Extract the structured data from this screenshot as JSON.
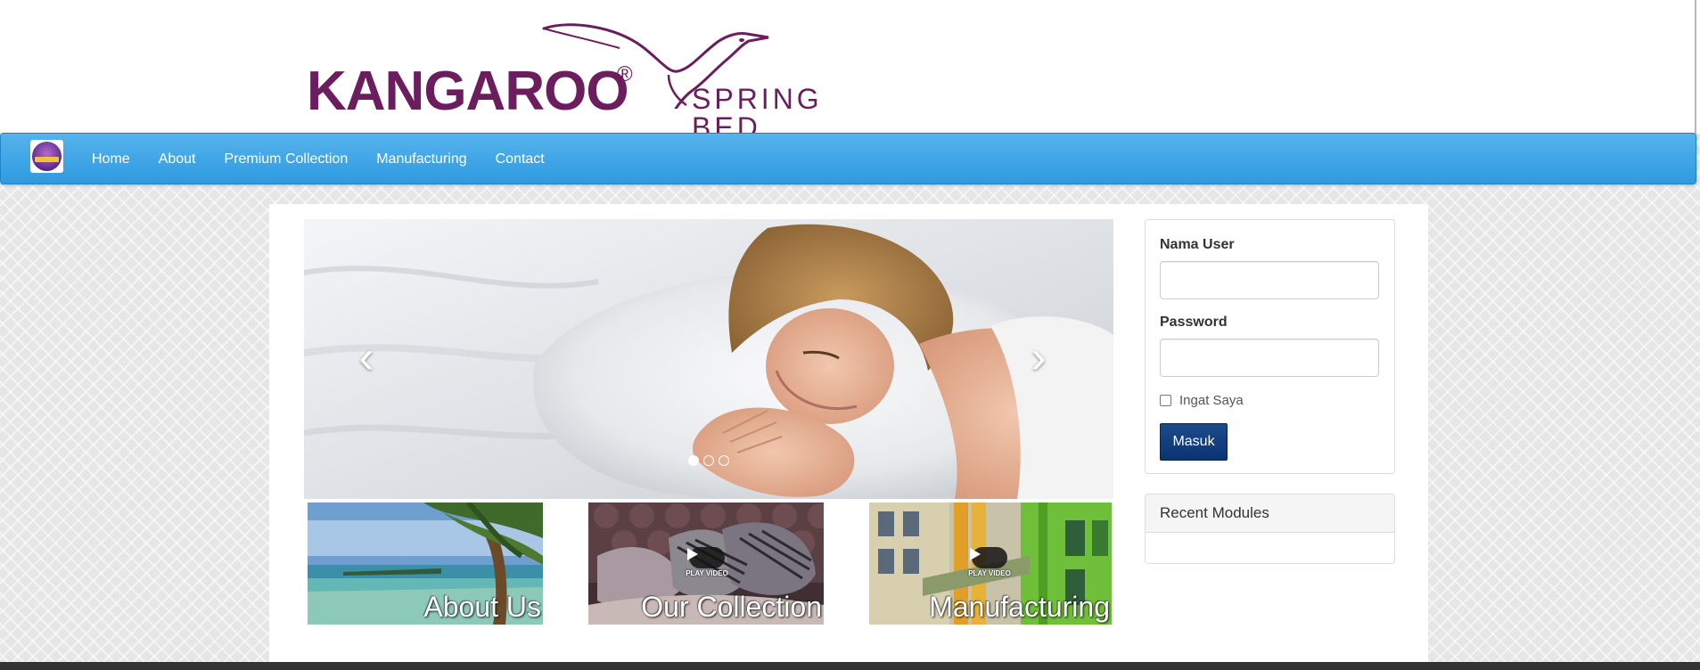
{
  "logo": {
    "wordmark": "KANGAROO",
    "registered": "®",
    "tagline": "SPRING BED",
    "color": "#6b1d5d"
  },
  "navbar": {
    "brand_icon": "kangaroo-badge-icon",
    "items": [
      {
        "label": "Home"
      },
      {
        "label": "About"
      },
      {
        "label": "Premium Collection"
      },
      {
        "label": "Manufacturing"
      },
      {
        "label": "Contact"
      }
    ],
    "color": "#3aa3e6"
  },
  "carousel": {
    "prev_icon": "chevron-left-icon",
    "next_icon": "chevron-right-icon",
    "slide_count": 3,
    "active_slide": 1
  },
  "thumbnails": [
    {
      "label": "About Us",
      "has_video": false
    },
    {
      "label": "Our Collection",
      "has_video": true,
      "video_label": "PLAY VIDEO"
    },
    {
      "label": "Manufacturing",
      "has_video": true,
      "video_label": "PLAY VIDEO"
    }
  ],
  "login": {
    "username_label": "Nama User",
    "username_value": "",
    "password_label": "Password",
    "password_value": "",
    "remember_label": "Ingat Saya",
    "remember_checked": false,
    "submit_label": "Masuk",
    "button_color": "#0b3372"
  },
  "recent_modules": {
    "heading": "Recent Modules"
  }
}
